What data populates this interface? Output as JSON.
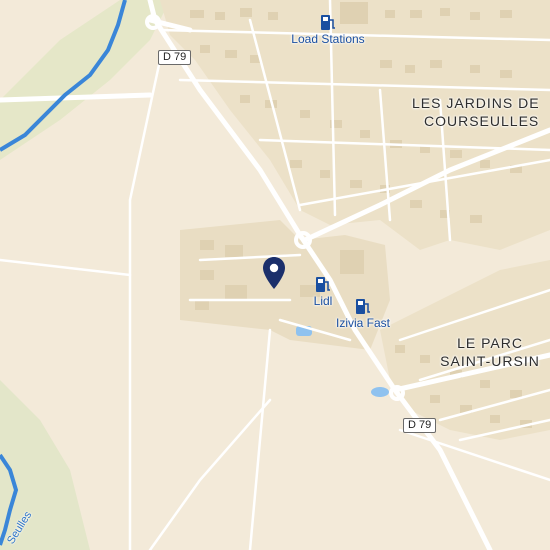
{
  "map": {
    "road_shields": [
      {
        "id": "d79-north",
        "label": "D 79"
      },
      {
        "id": "d79-south",
        "label": "D 79"
      }
    ],
    "places": [
      {
        "id": "les-jardins",
        "line1": "LES JARDINS DE",
        "line2": "COURSEULLES"
      },
      {
        "id": "le-parc",
        "line1": "LE PARC",
        "line2": "SAINT-URSIN"
      }
    ],
    "river": {
      "label": "Seulles"
    },
    "pois": [
      {
        "id": "load-stations",
        "label": "Load Stations",
        "icon": "ev-charging-station-icon"
      },
      {
        "id": "lidl",
        "label": "Lidl",
        "icon": "ev-charging-station-icon"
      },
      {
        "id": "izivia-fast",
        "label": "Izivia Fast",
        "icon": "ev-charging-station-icon"
      }
    ],
    "marker": {
      "icon": "location-pin-icon"
    },
    "colors": {
      "land": "#f3ead9",
      "urban": "#ece1c8",
      "park": "#dde6c4",
      "water": "#3a86d8",
      "road": "#ffffff",
      "poi_blue": "#1a4fa0",
      "pin": "#1b2f6b"
    }
  }
}
